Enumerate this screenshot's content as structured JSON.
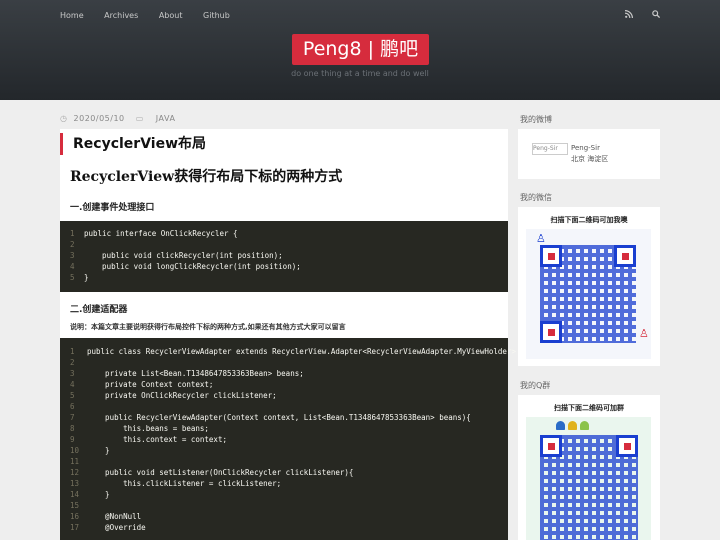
{
  "nav": {
    "items": [
      "Home",
      "Archives",
      "About",
      "Github"
    ],
    "rss_icon": "rss-icon",
    "search_icon": "search-icon"
  },
  "site": {
    "brand": "Peng8 | 鹏吧",
    "tagline": "do one thing at a time and do well"
  },
  "post": {
    "date": "2020/05/10",
    "category": "JAVA",
    "title": "RecyclerView布局",
    "heading": "RecyclerView获得行布局下标的两种方式",
    "section1": "一.创建事件处理接口",
    "section2": "二.创建适配器",
    "note": "说明：本篇文章主要说明获得行布局控件下标的两种方式,如果还有其他方式大家可以留言",
    "code1": [
      {
        "n": "1",
        "t": "public interface OnClickRecycler {"
      },
      {
        "n": "2",
        "t": ""
      },
      {
        "n": "3",
        "t": "    public void clickRecycler(int position);"
      },
      {
        "n": "4",
        "t": "    public void longClickRecycler(int position);"
      },
      {
        "n": "5",
        "t": "}"
      }
    ],
    "code2": [
      {
        "n": "1",
        "t": "public class RecyclerViewAdapter extends RecyclerView.Adapter<RecyclerViewAdapter.MyViewHolder> {"
      },
      {
        "n": "2",
        "t": ""
      },
      {
        "n": "3",
        "t": "    private List<Bean.T1348647853363Bean> beans;"
      },
      {
        "n": "4",
        "t": "    private Context context;"
      },
      {
        "n": "5",
        "t": "    private OnClickRecycler clickListener;"
      },
      {
        "n": "6",
        "t": ""
      },
      {
        "n": "7",
        "t": "    public RecyclerViewAdapter(Context context, List<Bean.T1348647853363Bean> beans){"
      },
      {
        "n": "8",
        "t": "        this.beans = beans;"
      },
      {
        "n": "9",
        "t": "        this.context = context;"
      },
      {
        "n": "10",
        "t": "    }"
      },
      {
        "n": "11",
        "t": ""
      },
      {
        "n": "12",
        "t": "    public void setListener(OnClickRecycler clickListener){"
      },
      {
        "n": "13",
        "t": "        this.clickListener = clickListener;"
      },
      {
        "n": "14",
        "t": "    }"
      },
      {
        "n": "15",
        "t": ""
      },
      {
        "n": "16",
        "t": "    @NonNull"
      },
      {
        "n": "17",
        "t": "    @Override"
      }
    ]
  },
  "sidebar": {
    "weibo_title": "我的微博",
    "weibo_img_alt": "Peng-Sir",
    "weibo_name": "Peng-Sir",
    "weibo_location": "北京 海淀区",
    "wechat_title": "我的微信",
    "wechat_caption": "扫描下面二维码可加我噢",
    "qq_title": "我的Q群",
    "qq_caption": "扫描下面二维码可加群"
  },
  "colors": {
    "accent": "#d62c3d",
    "header_bg": "#2c3035",
    "code_bg": "#272822",
    "qr_blue": "#1a3fd0"
  }
}
